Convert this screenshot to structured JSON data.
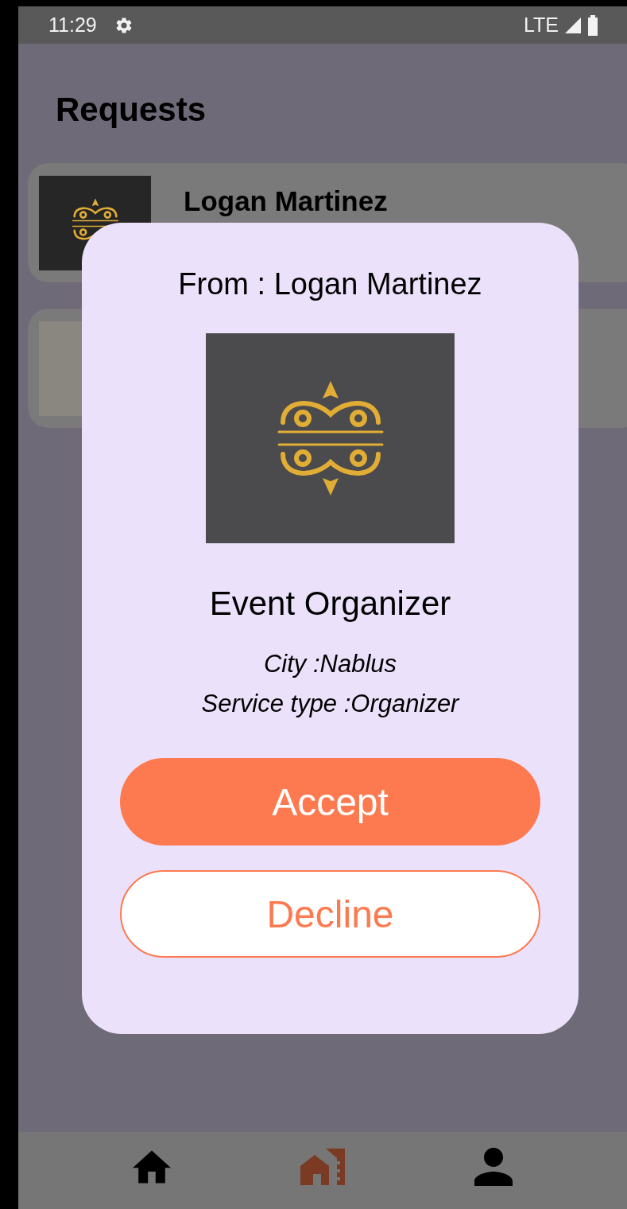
{
  "status_bar": {
    "time": "11:29",
    "network": "LTE"
  },
  "title": "Requests",
  "requests": [
    {
      "kind": "logo",
      "name": "Logan Martinez"
    },
    {
      "kind": "photo"
    }
  ],
  "dialog": {
    "from": "From : Logan Martinez",
    "title": "Event Organizer",
    "details": [
      "City :Nablus",
      "Service type :Organizer"
    ],
    "buttons": [
      {
        "label": "Accept",
        "kind": "primary"
      },
      {
        "label": "Decline",
        "kind": "outline"
      }
    ]
  },
  "nav": [
    {
      "kind": "home",
      "selected": false
    },
    {
      "kind": "buildings",
      "selected": true
    },
    {
      "kind": "profile",
      "selected": false
    }
  ]
}
